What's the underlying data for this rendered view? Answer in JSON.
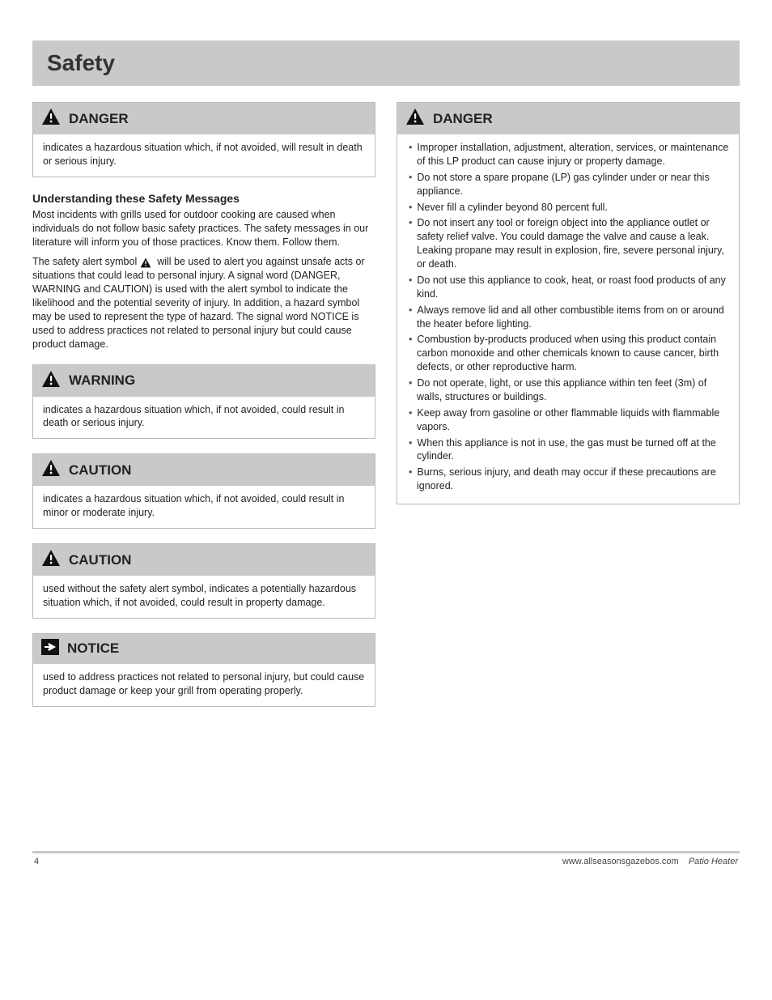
{
  "title": "Safety",
  "left": {
    "danger": {
      "label": "DANGER",
      "body": "indicates a hazardous situation which, if not avoided, will result in death or serious injury."
    },
    "intro": {
      "heading": "Understanding these Safety Messages",
      "p1": "Most incidents with grills used for outdoor cooking are caused when individuals do not follow basic safety practices. The safety messages in our literature will inform you of those practices. Know them. Follow them.",
      "p2_pre": "The safety alert symbol  ",
      "p2_post": "  will be used to alert you against unsafe acts or situations that could lead to personal injury. A signal word (DANGER, WARNING and CAUTION) is used with the alert symbol to indicate the likelihood and the potential severity of injury. In addition, a hazard symbol may be used to represent the type of hazard. The signal word NOTICE is used to address practices not related to personal injury but could cause product damage."
    },
    "warning": {
      "label": "WARNING",
      "body": "indicates a hazardous situation which, if not avoided, could result in death or serious injury."
    },
    "caution": {
      "label": "CAUTION",
      "body": "indicates a hazardous situation which, if not avoided, could result in minor or moderate injury."
    },
    "caution2": {
      "label": "CAUTION",
      "body": "used without the safety alert symbol, indicates a potentially hazardous situation which, if not avoided, could result in property damage."
    },
    "notice": {
      "label": "NOTICE",
      "body": "used to address practices not related to personal injury, but could cause product damage or keep your grill from operating properly."
    }
  },
  "right": {
    "label": "DANGER",
    "items": [
      "Improper installation, adjustment, alteration, services, or maintenance of this LP product can cause injury or property damage.",
      "Do not store a spare propane (LP) gas cylinder under or near this appliance.",
      "Never fill a cylinder beyond 80 percent full.",
      "Do not insert any tool or foreign object into the appliance outlet or safety relief valve. You could damage the valve and cause a leak. Leaking propane may result in explosion, fire, severe personal injury, or death.",
      "Do not use this appliance to cook, heat, or roast food products of any kind.",
      "Always remove lid and all other combustible items from on or around the heater before lighting.",
      "Combustion by-products produced when using this product contain carbon monoxide and other chemicals known to cause cancer, birth defects, or other reproductive harm.",
      "Do not operate, light, or use this appliance within ten feet (3m) of walls, structures or buildings.",
      "Keep away from gasoline or other flammable liquids with flammable vapors.",
      "When this appliance is not in use, the gas must be turned off at the cylinder.",
      "Burns, serious injury, and death may occur if these precautions are ignored."
    ]
  },
  "footer": {
    "left": "4",
    "right_a": "www.allseasonsgazebos.com",
    "right_b": "Patio Heater"
  }
}
